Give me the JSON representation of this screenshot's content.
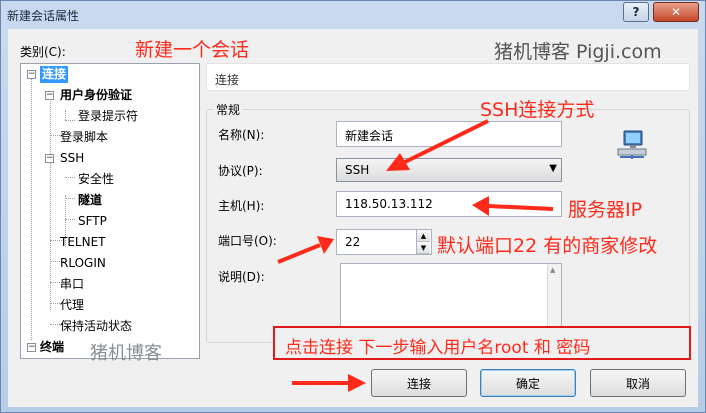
{
  "window": {
    "title": "新建会话属性",
    "help_label": "?",
    "close_label": "✕"
  },
  "tree": {
    "category_label": "类别(C):",
    "items": [
      {
        "label": "连接",
        "selected": true
      },
      {
        "label": "用户身份验证"
      },
      {
        "label": "登录提示符"
      },
      {
        "label": "登录脚本"
      },
      {
        "label": "SSH"
      },
      {
        "label": "安全性"
      },
      {
        "label": "隧道"
      },
      {
        "label": "SFTP"
      },
      {
        "label": "TELNET"
      },
      {
        "label": "RLOGIN"
      },
      {
        "label": "串口"
      },
      {
        "label": "代理"
      },
      {
        "label": "保持活动状态"
      },
      {
        "label": "终端"
      }
    ],
    "expand_minus": "−"
  },
  "panel": {
    "header": "连接",
    "group_title": "常规",
    "name_label": "名称(N):",
    "name_value": "新建会话",
    "protocol_label": "协议(P):",
    "protocol_value": "SSH",
    "host_label": "主机(H):",
    "host_value": "118.50.13.112",
    "port_label": "端口号(O):",
    "port_value": "22",
    "desc_label": "说明(D):",
    "icon": "network-computer-icon"
  },
  "buttons": {
    "connect": "连接",
    "ok": "确定",
    "cancel": "取消"
  },
  "annotations": {
    "new_session": "新建一个会话",
    "watermark": "猪机博客 Pigji.com",
    "ssh_method": "SSH连接方式",
    "server_ip": "服务器IP",
    "default_port": "默认端口22  有的商家修改",
    "watermark2": "猪机博客",
    "next_step": "点击连接 下一步输入用户名root  和 密码"
  },
  "colors": {
    "annotation": "#ff2a1a",
    "selection": "#3399ff"
  }
}
